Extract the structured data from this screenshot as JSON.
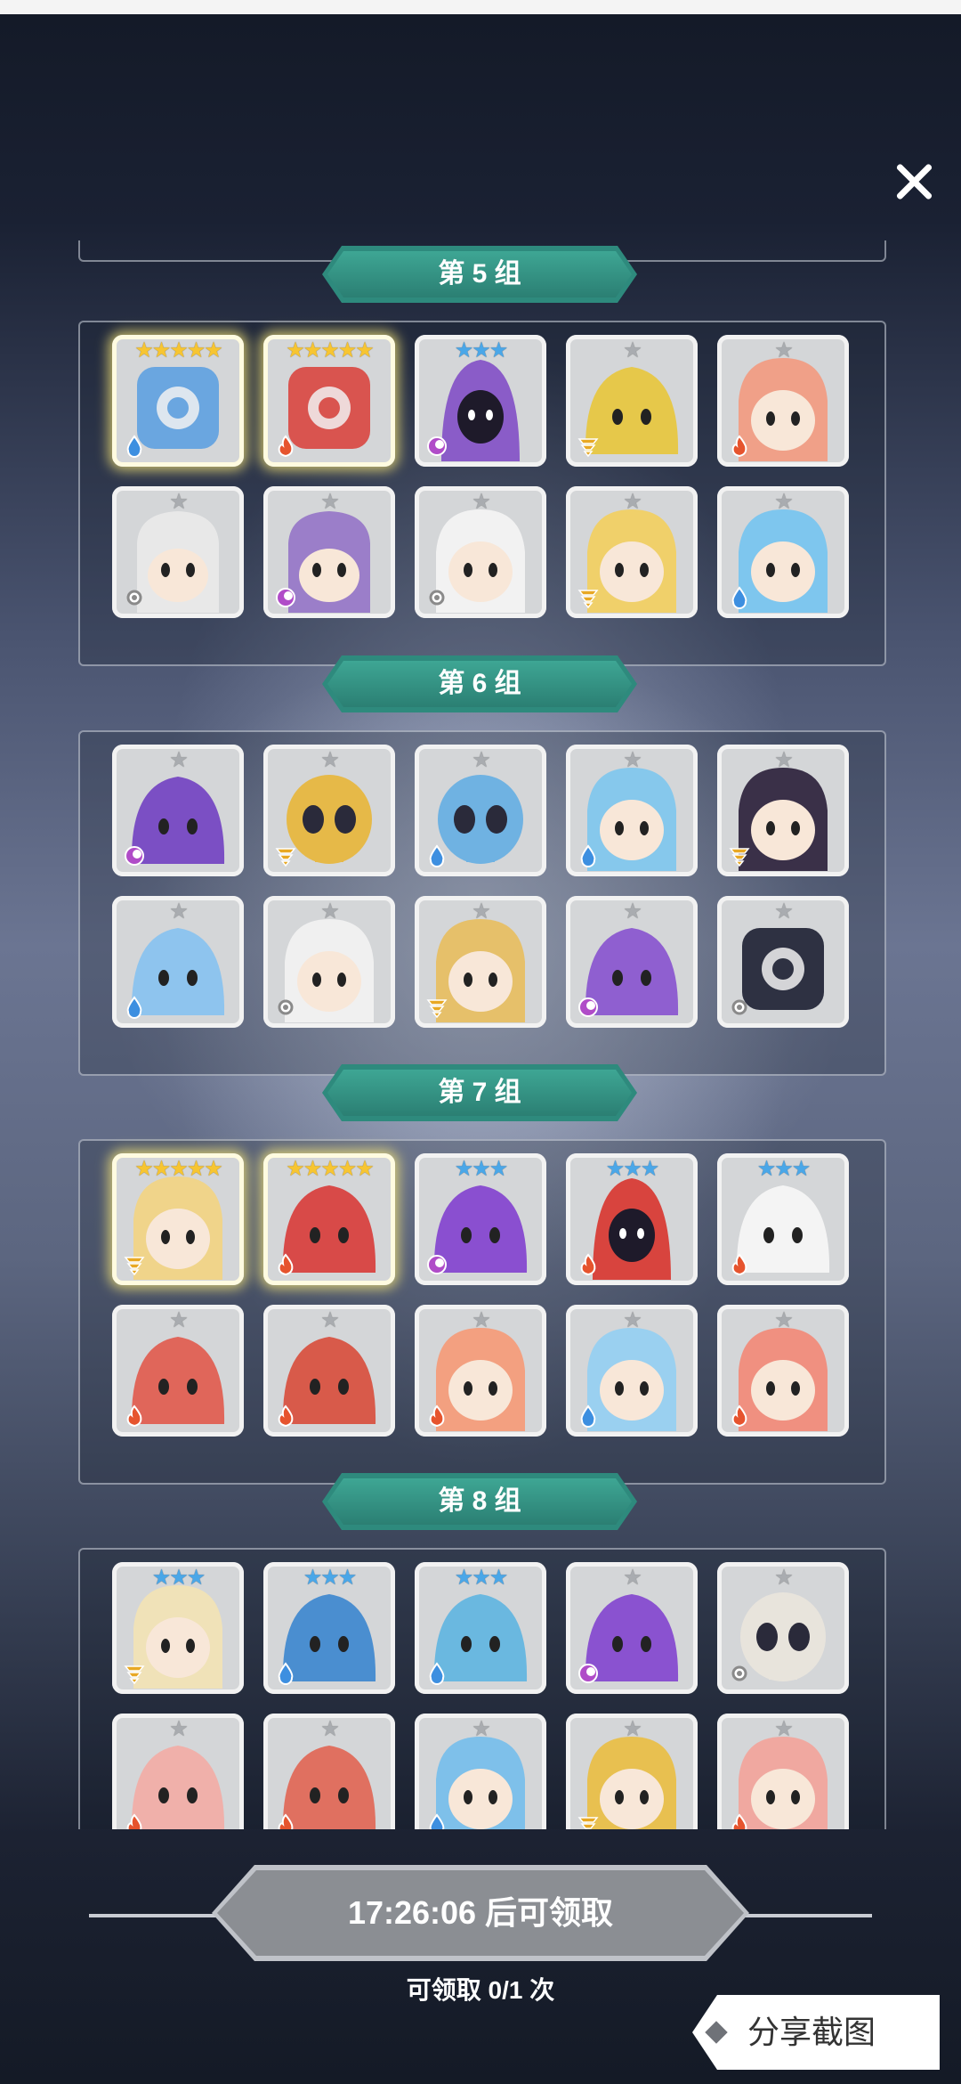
{
  "close_icon": "close-icon",
  "groups": [
    {
      "label": "第 5 组",
      "cards": [
        {
          "stars": 5,
          "rank": "gold",
          "element": "water",
          "color": "#6aa6e0",
          "shape": "robot"
        },
        {
          "stars": 5,
          "rank": "gold",
          "element": "fire",
          "color": "#d9544f",
          "shape": "robot"
        },
        {
          "stars": 3,
          "rank": "blue",
          "element": "dark",
          "color": "#8a5cc8",
          "shape": "hood"
        },
        {
          "stars": 1,
          "rank": "grey",
          "element": "wind",
          "color": "#e6c84a",
          "shape": "blob"
        },
        {
          "stars": 1,
          "rank": "grey",
          "element": "fire",
          "color": "#f0a088",
          "shape": "girl"
        },
        {
          "stars": 1,
          "rank": "grey",
          "element": "light",
          "color": "#e8e8e8",
          "shape": "knight"
        },
        {
          "stars": 1,
          "rank": "grey",
          "element": "dark",
          "color": "#9b7ec9",
          "shape": "knight"
        },
        {
          "stars": 1,
          "rank": "grey",
          "element": "light",
          "color": "#f2f2f2",
          "shape": "girl"
        },
        {
          "stars": 1,
          "rank": "grey",
          "element": "wind",
          "color": "#f0d06a",
          "shape": "girl"
        },
        {
          "stars": 1,
          "rank": "grey",
          "element": "water",
          "color": "#7ec6ee",
          "shape": "girl"
        }
      ]
    },
    {
      "label": "第 6 组",
      "cards": [
        {
          "stars": 1,
          "rank": "grey",
          "element": "dark",
          "color": "#7b4fc4",
          "shape": "blob"
        },
        {
          "stars": 1,
          "rank": "grey",
          "element": "wind",
          "color": "#e6b948",
          "shape": "skull"
        },
        {
          "stars": 1,
          "rank": "grey",
          "element": "water",
          "color": "#6fb2e2",
          "shape": "skull"
        },
        {
          "stars": 1,
          "rank": "grey",
          "element": "water",
          "color": "#86c8ec",
          "shape": "girl"
        },
        {
          "stars": 1,
          "rank": "grey",
          "element": "wind",
          "color": "#3a3048",
          "shape": "girl"
        },
        {
          "stars": 1,
          "rank": "grey",
          "element": "water",
          "color": "#8ec4ee",
          "shape": "blob"
        },
        {
          "stars": 1,
          "rank": "grey",
          "element": "light",
          "color": "#f0f0f0",
          "shape": "girl"
        },
        {
          "stars": 1,
          "rank": "grey",
          "element": "wind",
          "color": "#e6c06a",
          "shape": "girl"
        },
        {
          "stars": 1,
          "rank": "grey",
          "element": "dark",
          "color": "#8f5fd0",
          "shape": "blob"
        },
        {
          "stars": 1,
          "rank": "grey",
          "element": "light",
          "color": "#2e3142",
          "shape": "robot"
        }
      ]
    },
    {
      "label": "第 7 组",
      "cards": [
        {
          "stars": 5,
          "rank": "gold",
          "element": "wind",
          "color": "#f0d48a",
          "shape": "girl"
        },
        {
          "stars": 5,
          "rank": "gold",
          "element": "fire",
          "color": "#d84a48",
          "shape": "blob"
        },
        {
          "stars": 3,
          "rank": "blue",
          "element": "dark",
          "color": "#8a4fd0",
          "shape": "blob"
        },
        {
          "stars": 3,
          "rank": "blue",
          "element": "fire",
          "color": "#d8443e",
          "shape": "hood"
        },
        {
          "stars": 3,
          "rank": "blue",
          "element": "fire",
          "color": "#f4f4f4",
          "shape": "blob"
        },
        {
          "stars": 1,
          "rank": "grey",
          "element": "fire",
          "color": "#e0665a",
          "shape": "blob"
        },
        {
          "stars": 1,
          "rank": "grey",
          "element": "fire",
          "color": "#d85a4a",
          "shape": "blob"
        },
        {
          "stars": 1,
          "rank": "grey",
          "element": "fire",
          "color": "#f3a080",
          "shape": "girl"
        },
        {
          "stars": 1,
          "rank": "grey",
          "element": "water",
          "color": "#9ad0f0",
          "shape": "girl"
        },
        {
          "stars": 1,
          "rank": "grey",
          "element": "fire",
          "color": "#f09080",
          "shape": "girl"
        }
      ]
    },
    {
      "label": "第 8 组",
      "cards": [
        {
          "stars": 3,
          "rank": "blue",
          "element": "wind",
          "color": "#f0e2b8",
          "shape": "girl"
        },
        {
          "stars": 3,
          "rank": "blue",
          "element": "water",
          "color": "#4a8ed0",
          "shape": "blob"
        },
        {
          "stars": 3,
          "rank": "blue",
          "element": "water",
          "color": "#6ab8e0",
          "shape": "blob"
        },
        {
          "stars": 1,
          "rank": "grey",
          "element": "dark",
          "color": "#8a52d0",
          "shape": "blob"
        },
        {
          "stars": 1,
          "rank": "grey",
          "element": "light",
          "color": "#e8e4dc",
          "shape": "skull"
        },
        {
          "stars": 1,
          "rank": "grey",
          "element": "fire",
          "color": "#f0b0aa",
          "shape": "blob"
        },
        {
          "stars": 1,
          "rank": "grey",
          "element": "fire",
          "color": "#e07060",
          "shape": "blob"
        },
        {
          "stars": 1,
          "rank": "grey",
          "element": "water",
          "color": "#7ec0ea",
          "shape": "girl"
        },
        {
          "stars": 1,
          "rank": "grey",
          "element": "wind",
          "color": "#e8c050",
          "shape": "girl"
        },
        {
          "stars": 1,
          "rank": "grey",
          "element": "fire",
          "color": "#f0a8a0",
          "shape": "girl"
        }
      ]
    }
  ],
  "element_colors": {
    "water": "#3d8fe0",
    "fire": "#e6542e",
    "dark": "#b04cc8",
    "wind": "#e8a824",
    "light": "#8a8a8a"
  },
  "timer_label": "17:26:06 后可领取",
  "claim_text": "可领取 0/1 次",
  "share_label": "分享截图"
}
